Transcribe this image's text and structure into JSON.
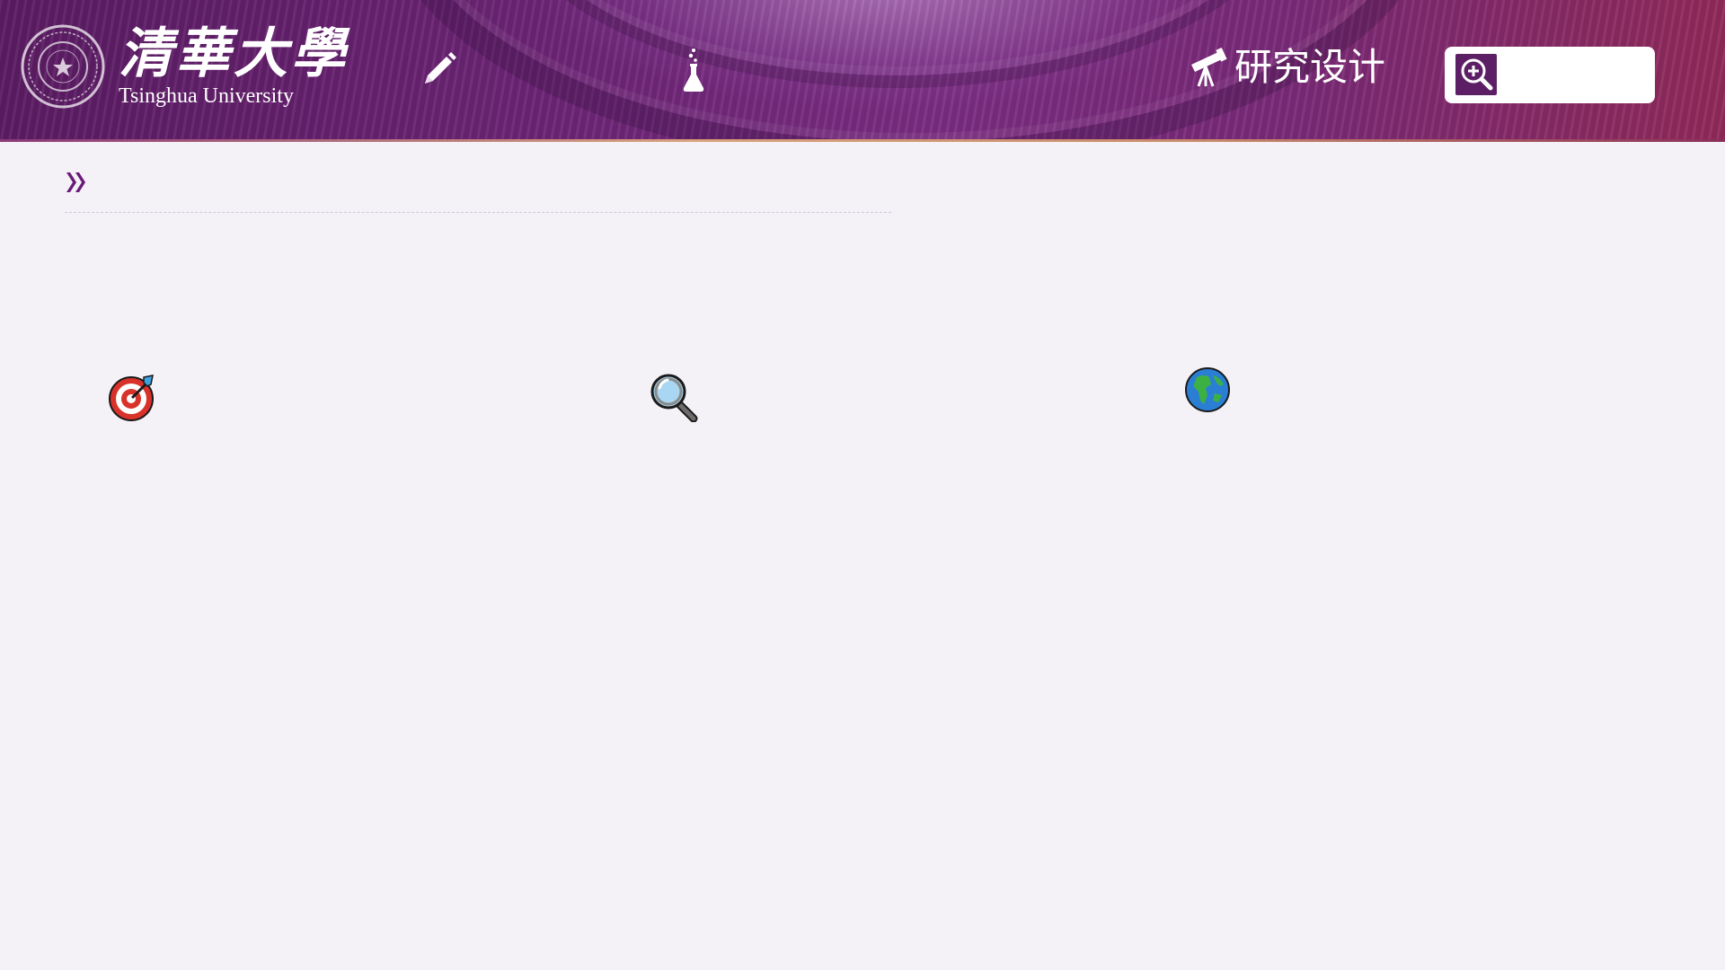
{
  "header": {
    "logo": {
      "name_cn": "清華大學",
      "name_en": "Tsinghua University",
      "seal_icon": "tsinghua-seal-icon"
    },
    "nav": {
      "pencil_icon": "pencil-icon",
      "flask_icon": "flask-icon",
      "research": {
        "icon": "telescope-icon",
        "label": "研究设计"
      }
    },
    "search": {
      "icon": "zoom-in-search-icon",
      "placeholder": "",
      "value": ""
    }
  },
  "content": {
    "breadcrumb_icon": "double-chevron-right-icon",
    "feature_icons": [
      "target-icon",
      "magnifier-icon",
      "globe-icon"
    ]
  },
  "colors": {
    "brand_purple": "#5c1f66",
    "background": "#f4f2f7",
    "accent_chevron": "#6b1a7a"
  }
}
